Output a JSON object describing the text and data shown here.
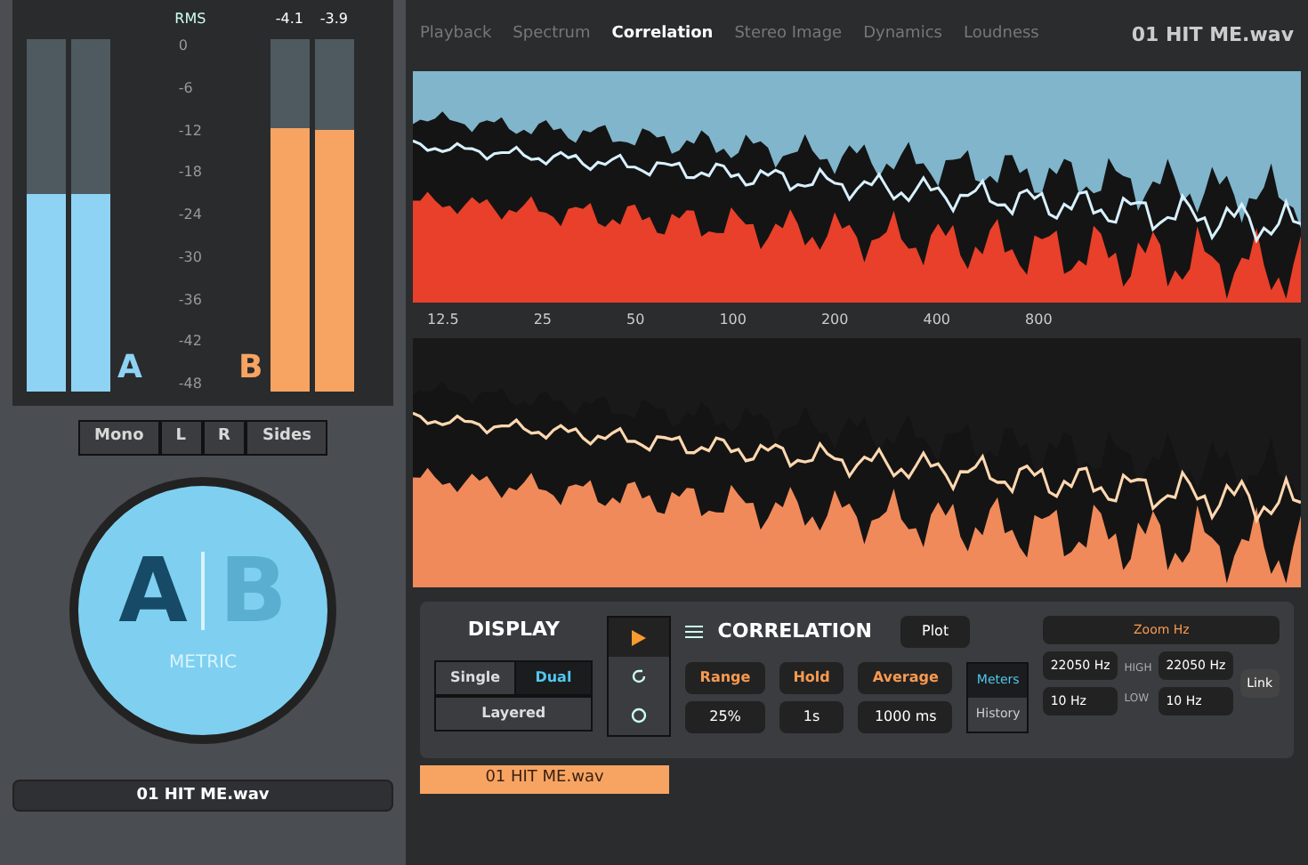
{
  "meters": {
    "label": "RMS",
    "scale": [
      "0",
      "-6",
      "-12",
      "-18",
      "-24",
      "-30",
      "-36",
      "-42",
      "-48"
    ],
    "groups": [
      {
        "letter": "A",
        "color": "#8fd3f4",
        "channels": [
          {
            "level": 0.56
          },
          {
            "level": 0.56
          }
        ]
      },
      {
        "letter": "B",
        "color": "#f7a463",
        "readings": [
          "-4.1",
          "-3.9"
        ],
        "channels": [
          {
            "level": 0.75
          },
          {
            "level": 0.74
          }
        ]
      }
    ]
  },
  "channel_modes": [
    {
      "label": "Mono",
      "selected": false
    },
    {
      "label": "L",
      "selected": false
    },
    {
      "label": "R",
      "selected": false
    },
    {
      "label": "Sides",
      "selected": false
    }
  ],
  "ab_switch": {
    "letters": [
      {
        "text": "A",
        "selected": true
      },
      {
        "text": "B",
        "selected": false
      }
    ],
    "label": "METRIC"
  },
  "file_name": "01 HIT ME.wav",
  "tabs": [
    {
      "label": "Playback",
      "selected": false
    },
    {
      "label": "Spectrum",
      "selected": false
    },
    {
      "label": "Correlation",
      "selected": true
    },
    {
      "label": "Stereo Image",
      "selected": false
    },
    {
      "label": "Dynamics",
      "selected": false
    },
    {
      "label": "Loudness",
      "selected": false
    }
  ],
  "track_title": "01 HIT ME.wav",
  "frequency_labels": [
    "12.5",
    "25",
    "50",
    "100",
    "200",
    "400",
    "800"
  ],
  "display": {
    "title": "DISPLAY",
    "modes": [
      {
        "label": "Single",
        "selected": false
      },
      {
        "label": "Dual",
        "selected": true
      },
      {
        "label": "Layered",
        "selected": false
      }
    ]
  },
  "correlation": {
    "title": "CORRELATION",
    "plot": "Plot",
    "controls": [
      {
        "label": "Range",
        "value": "25%"
      },
      {
        "label": "Hold",
        "value": "1s"
      },
      {
        "label": "Average",
        "value": "1000 ms"
      }
    ],
    "views": [
      {
        "label": "Meters",
        "selected": true
      },
      {
        "label": "History",
        "selected": false
      }
    ]
  },
  "zoom": {
    "label": "Zoom Hz",
    "high_label": "HIGH",
    "low_label": "LOW",
    "left": [
      "22050 Hz",
      "10 Hz"
    ],
    "right": [
      "22050 Hz",
      "10 Hz"
    ],
    "link": "Link"
  },
  "tracks": [
    {
      "name": "01 HIT ME.wav",
      "selected": true
    }
  ]
}
